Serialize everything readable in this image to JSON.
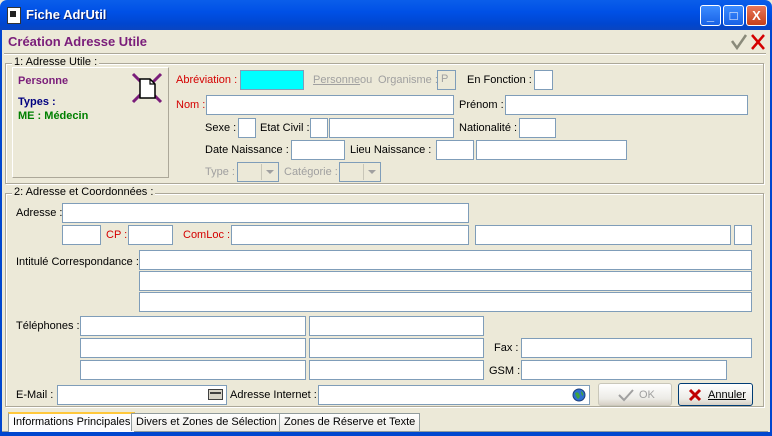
{
  "window": {
    "title": "Fiche AdrUtil",
    "minimize": "_",
    "maximize": "□",
    "close": "X"
  },
  "form": {
    "title": "Création Adresse Utile"
  },
  "group1": {
    "label": "1: Adresse Utile :",
    "type_person": "Personne",
    "types_label": "Types :",
    "types_value": "ME : Médecin",
    "abreviation_label": "Abréviation :",
    "abreviation_value": "",
    "personne_label": "Personne",
    "ou_label": "ou",
    "organisme_label": "Organisme :",
    "po_value": "P",
    "en_fonction_label": "En Fonction :",
    "nom_label": "Nom :",
    "prenom_label": "Prénom :",
    "sexe_label": "Sexe :",
    "etat_civil_label": "Etat Civil :",
    "nationalite_label": "Nationalité :",
    "date_naissance_label": "Date Naissance :",
    "lieu_naissance_label": "Lieu Naissance :",
    "type_label": "Type :",
    "categorie_label": "Catégorie :"
  },
  "group2": {
    "label": "2: Adresse et Coordonnées :",
    "adresse_label": "Adresse :",
    "cp_label": "CP :",
    "comloc_label": "ComLoc :",
    "intitule_label": "Intitulé Correspondance :",
    "telephones_label": "Téléphones :",
    "fax_label": "Fax :",
    "gsm_label": "GSM :",
    "email_label": "E-Mail :",
    "internet_label": "Adresse Internet :"
  },
  "buttons": {
    "ok": "OK",
    "annuler": "Annuler"
  },
  "tabs": [
    "Informations Principales",
    "Divers et Zones de Sélection",
    "Zones de Réserve et Texte"
  ],
  "colors": {
    "title_bar": "#0054E3",
    "form_title": "#7A1D7A",
    "required_label": "#D40000",
    "types_value": "#008000",
    "highlight_field": "#00FFFF"
  }
}
